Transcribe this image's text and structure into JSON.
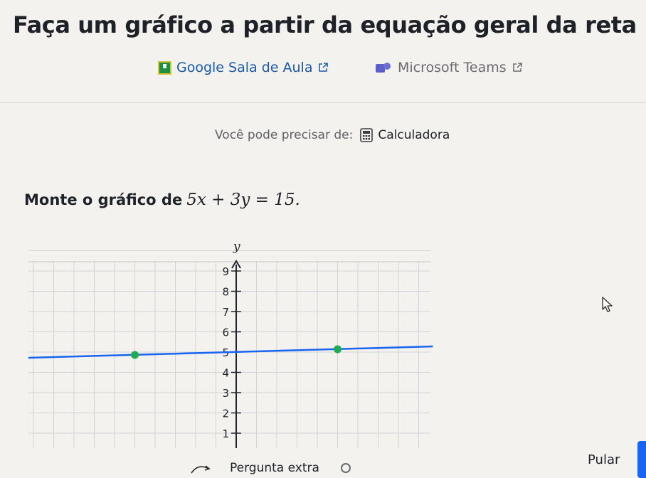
{
  "page": {
    "title": "Faça um gráfico a partir da equação geral da reta"
  },
  "share": {
    "google_classroom": "Google Sala de Aula",
    "microsoft_teams": "Microsoft Teams"
  },
  "tools": {
    "prefix": "Você pode precisar de:",
    "calculator": "Calculadora"
  },
  "problem": {
    "prompt": "Monte o gráfico de",
    "equation": "5x + 3y = 15."
  },
  "graph": {
    "axis_label_y": "y",
    "y_tick_labels": [
      "1",
      "2",
      "3",
      "4",
      "5",
      "6",
      "7",
      "8",
      "9"
    ],
    "line_color": "#1865f2",
    "point_color": "#1fab54",
    "points": [
      {
        "x": -5,
        "y": 5
      },
      {
        "x": 5,
        "y": 5
      }
    ]
  },
  "footer": {
    "extra_question": "Pergunta extra",
    "skip": "Pular"
  },
  "icons": {
    "google_classroom": "google-classroom-icon",
    "microsoft_teams": "microsoft-teams-icon",
    "external_link": "external-link-icon",
    "calculator": "calculator-icon",
    "cursor": "mouse-cursor-icon"
  }
}
